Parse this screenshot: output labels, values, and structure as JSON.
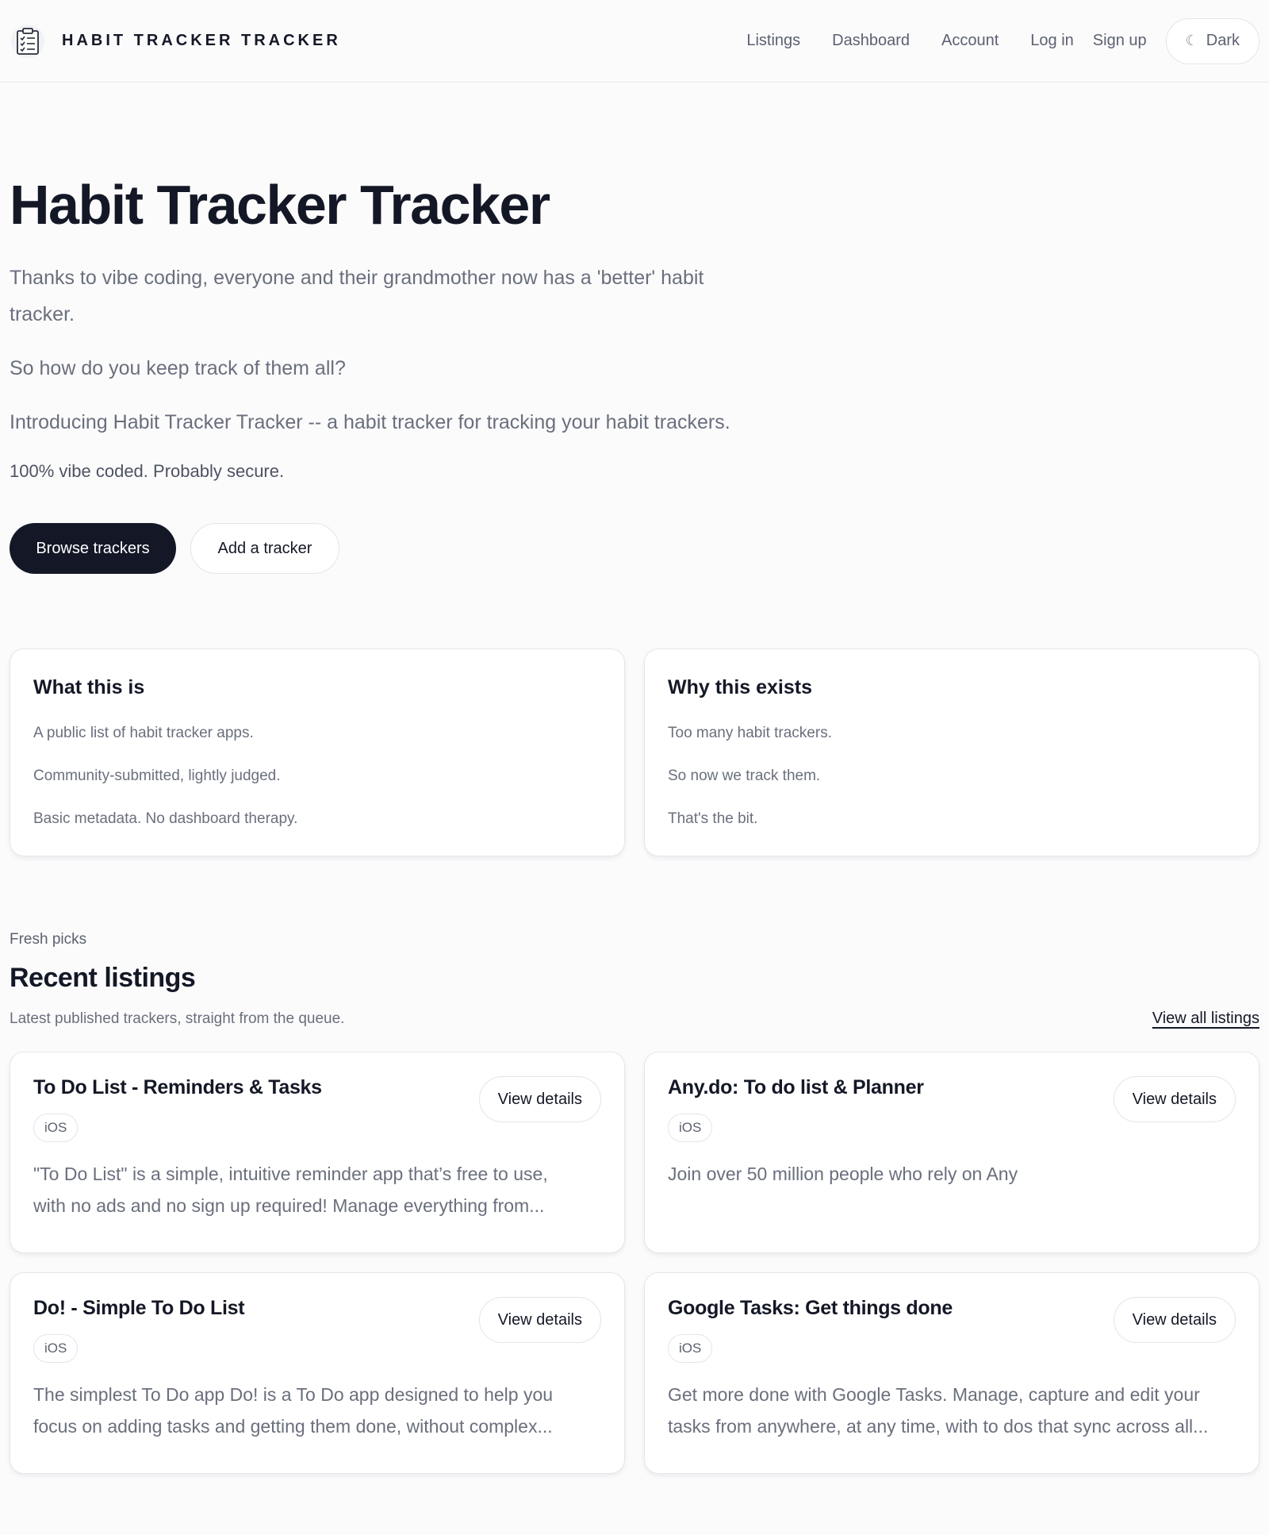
{
  "nav": {
    "brand": "HABIT TRACKER TRACKER",
    "links": [
      "Listings",
      "Dashboard",
      "Account",
      "Log in",
      "Sign up"
    ],
    "theme_icon": "moon-icon",
    "theme_label": "Dark"
  },
  "hero": {
    "title": "Habit Tracker Tracker",
    "paragraphs": [
      "Thanks to vibe coding, everyone and their grandmother now has a 'better' habit tracker.",
      "So how do you keep track of them all?",
      "Introducing Habit Tracker Tracker -- a habit tracker for tracking your habit trackers."
    ],
    "note": "100% vibe coded. Probably secure.",
    "primary_button": "Browse trackers",
    "secondary_button": "Add a tracker"
  },
  "info_cards": [
    {
      "title": "What this is",
      "lines": [
        "A public list of habit tracker apps.",
        "Community-submitted, lightly judged.",
        "Basic metadata. No dashboard therapy."
      ]
    },
    {
      "title": "Why this exists",
      "lines": [
        "Too many habit trackers.",
        "So now we track them.",
        "That's the bit."
      ]
    }
  ],
  "recent": {
    "eyebrow": "Fresh picks",
    "title": "Recent listings",
    "subtitle": "Latest published trackers, straight from the queue.",
    "view_all": "View all listings",
    "view_details_label": "View details",
    "listings": [
      {
        "title": "To Do List - Reminders & Tasks",
        "platform": "iOS",
        "description": "\"To Do List\" is a simple, intuitive reminder app that’s free to use, with no ads and no sign up required! Manage everything from..."
      },
      {
        "title": "Any.do: To do list & Planner",
        "platform": "iOS",
        "description": "Join over 50 million people who rely on Any"
      },
      {
        "title": "Do! - Simple To Do List",
        "platform": "iOS",
        "description": "The simplest To Do app Do! is a To Do app designed to help you focus on adding tasks and getting them done, without complex..."
      },
      {
        "title": "Google Tasks: Get things done",
        "platform": "iOS",
        "description": "Get more done with Google Tasks. Manage, capture and edit your tasks from anywhere, at any time, with to dos that sync across all..."
      }
    ]
  }
}
